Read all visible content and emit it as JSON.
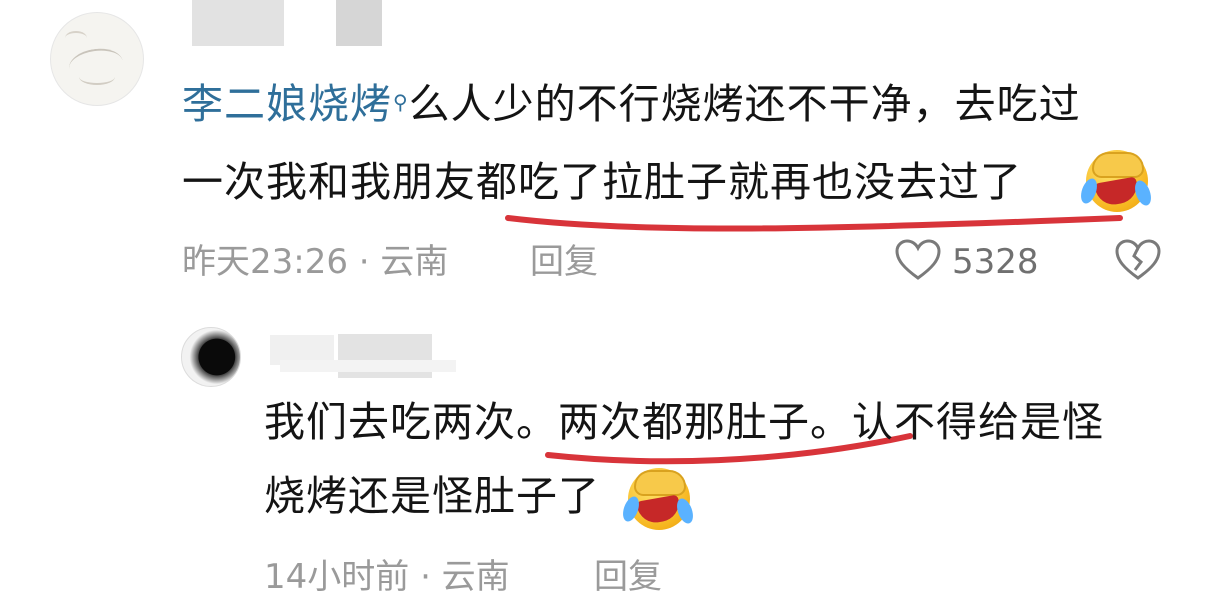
{
  "comments": [
    {
      "mention": "李二娘烧烤",
      "text_line1_rest": "么人少的不行烧烤还不干净，去吃过",
      "text_line2": "一次我和我朋友都吃了拉肚子就再也没去过了",
      "time_location": "昨天23:26 · 云南",
      "reply_label": "回复",
      "like_count": "5328"
    },
    {
      "text_line1": "我们去吃两次。两次都那肚子。认不得给是怪",
      "text_line2": "烧烤还是怪肚子了",
      "time_location": "14小时前 · 云南",
      "reply_label": "回复"
    }
  ],
  "colors": {
    "mention": "#2f6f9a",
    "meta": "#9a9a9a",
    "underline": "#d8343a"
  },
  "icons": [
    "search-icon",
    "heart-icon",
    "dislike-heart-icon",
    "laughing-crying-emoji"
  ]
}
